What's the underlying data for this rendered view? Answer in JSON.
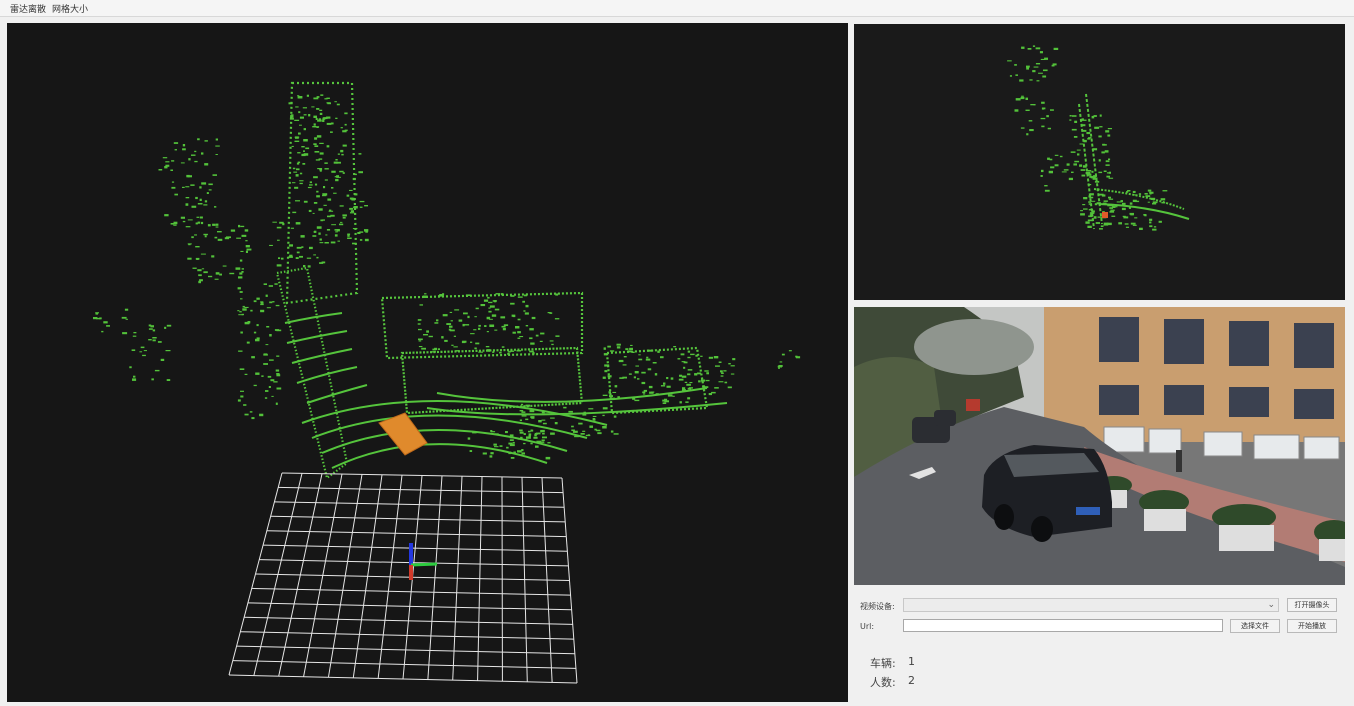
{
  "menu": [
    "雷达离散",
    "网格大小"
  ],
  "source": {
    "device_label": "视频设备:",
    "device_value": "",
    "url_label": "Url:",
    "url_value": "",
    "open_camera_button": "打开摄像头",
    "select_file_button": "选择文件",
    "start_play_button": "开始播放"
  },
  "stats": [
    {
      "label": "车辆:",
      "value": "1"
    },
    {
      "label": "人数:",
      "value": "2"
    }
  ],
  "colors": {
    "point_cloud": "#53c23a",
    "detected_vehicle": "#e08a2c",
    "grid": "#e6e6e6",
    "axis_x": "#2ecc40",
    "axis_y": "#2438e0",
    "axis_z": "#d23a2a",
    "background": "#161616"
  }
}
